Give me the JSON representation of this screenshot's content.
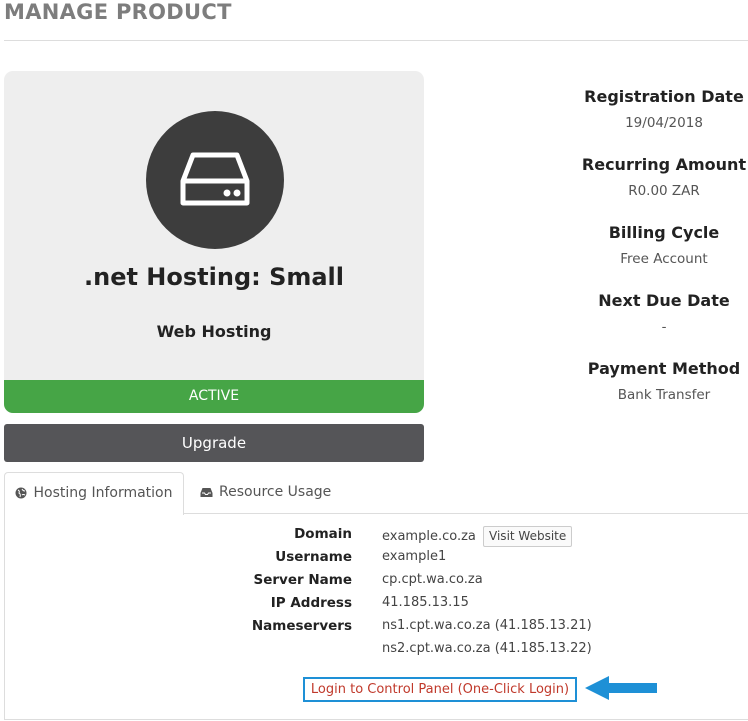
{
  "header": {
    "title": "MANAGE PRODUCT"
  },
  "product": {
    "icon": "server-icon",
    "name": ".net Hosting: Small",
    "group": "Web Hosting",
    "status": "ACTIVE",
    "upgrade_label": "Upgrade"
  },
  "details": [
    {
      "label": "Registration Date",
      "value": "19/04/2018"
    },
    {
      "label": "Recurring Amount",
      "value": "R0.00 ZAR"
    },
    {
      "label": "Billing Cycle",
      "value": "Free Account"
    },
    {
      "label": "Next Due Date",
      "value": "-"
    },
    {
      "label": "Payment Method",
      "value": "Bank Transfer"
    }
  ],
  "tabs": [
    {
      "label": "Hosting Information",
      "icon": "globe-icon",
      "active": true
    },
    {
      "label": "Resource Usage",
      "icon": "inbox-icon",
      "active": false
    }
  ],
  "hosting": {
    "domain_label": "Domain",
    "domain": "example.co.za",
    "visit_label": "Visit Website",
    "username_label": "Username",
    "username": "example1",
    "server_label": "Server Name",
    "server": "cp.cpt.wa.co.za",
    "ip_label": "IP Address",
    "ip": "41.185.13.15",
    "ns_label": "Nameservers",
    "ns1": "ns1.cpt.wa.co.za (41.185.13.21)",
    "ns2": "ns2.cpt.wa.co.za (41.185.13.22)"
  },
  "login_label": "Login to Control Panel (One-Click Login)",
  "colors": {
    "status": "#46a546",
    "upgrade": "#555558",
    "highlight": "#1e90d6",
    "link": "#c0392b"
  }
}
